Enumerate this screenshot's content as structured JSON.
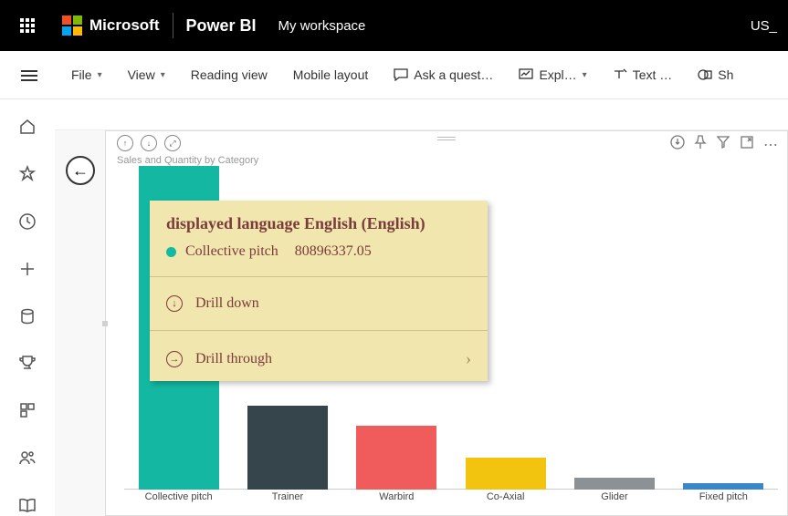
{
  "topbar": {
    "brand": "Microsoft",
    "product": "Power BI",
    "workspace": "My workspace",
    "right": "US_"
  },
  "commands": {
    "file": "File",
    "view": "View",
    "reading": "Reading view",
    "mobile": "Mobile layout",
    "ask": "Ask a quest…",
    "explore": "Expl…",
    "text": "Text …",
    "shapes": "Sh"
  },
  "visual": {
    "title": "Sales and Quantity by Category"
  },
  "chart_data": {
    "type": "bar",
    "title": "Sales and Quantity by Category",
    "categories": [
      "Collective pitch",
      "Trainer",
      "Warbird",
      "Co-Axial",
      "Glider",
      "Fixed pitch"
    ],
    "values": [
      80896337.05,
      21000000,
      16000000,
      8000000,
      3000000,
      500000
    ],
    "colors": [
      "#14b8a2",
      "#36454c",
      "#f05c5c",
      "#f2c40f",
      "#8c9196",
      "#3a86c8"
    ],
    "ylim": [
      0,
      81000000
    ]
  },
  "tooltip": {
    "title": "displayed language English (English)",
    "category": "Collective pitch",
    "value": "80896337.05",
    "drill_down": "Drill down",
    "drill_through": "Drill through"
  }
}
